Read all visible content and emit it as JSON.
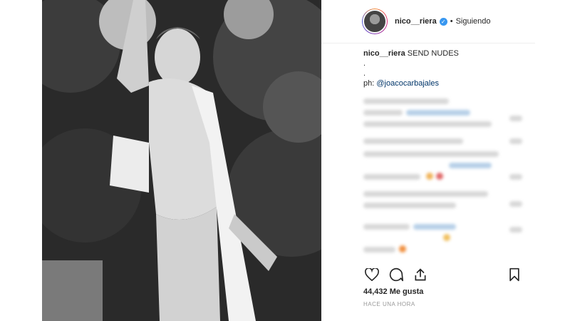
{
  "post": {
    "username": "nico__riera",
    "follow_status": "Siguiendo",
    "separator": "•",
    "caption_user": "nico__riera",
    "caption_text": "SEND NUDES",
    "caption_filler_1": ".",
    "caption_filler_2": ".",
    "credit_prefix": "ph: ",
    "credit_mention": "@joacocarbajales",
    "likes": "44,432 Me gusta",
    "timestamp": "HACE UNA HORA"
  },
  "icons": {
    "like": "heart-icon",
    "comment": "comment-icon",
    "share": "share-icon",
    "save": "bookmark-icon",
    "verified": "verified-badge-icon"
  },
  "colors": {
    "verified": "#3897f0",
    "mention": "#003569",
    "text": "#262626",
    "muted": "#999999"
  }
}
